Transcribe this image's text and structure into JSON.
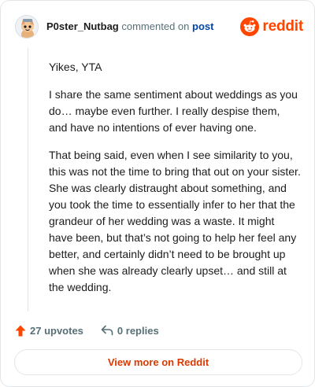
{
  "header": {
    "username": "P0ster_Nutbag",
    "action_text": "commented on",
    "post_link": "post",
    "brand": "reddit"
  },
  "comment": {
    "paragraphs": [
      "Yikes, YTA",
      "I share the same sentiment about weddings as you do… maybe even further. I really despise them, and have no intentions of ever having one.",
      "That being said, even when I see similarity to you, this was not the time to bring that out on your sister. She was clearly distraught about something, and you took the time to essentially infer to her that the grandeur of her wedding was a waste. It might have been, but that’s not going to help her feel any better, and certainly didn’t need to be brought up when she was already clearly upset… and still at the wedding."
    ]
  },
  "actions": {
    "upvotes": "27 upvotes",
    "replies": "0 replies"
  },
  "footer": {
    "view_more": "View more on Reddit"
  },
  "colors": {
    "brand": "#ff4500",
    "link": "#0045ac",
    "view_more": "#d93a00",
    "muted": "#576f76"
  },
  "icons": {
    "avatar": "snoo-avatar-icon",
    "brand": "reddit-snoo-icon",
    "upvote": "upvote-arrow-icon",
    "reply": "reply-arrow-icon"
  }
}
